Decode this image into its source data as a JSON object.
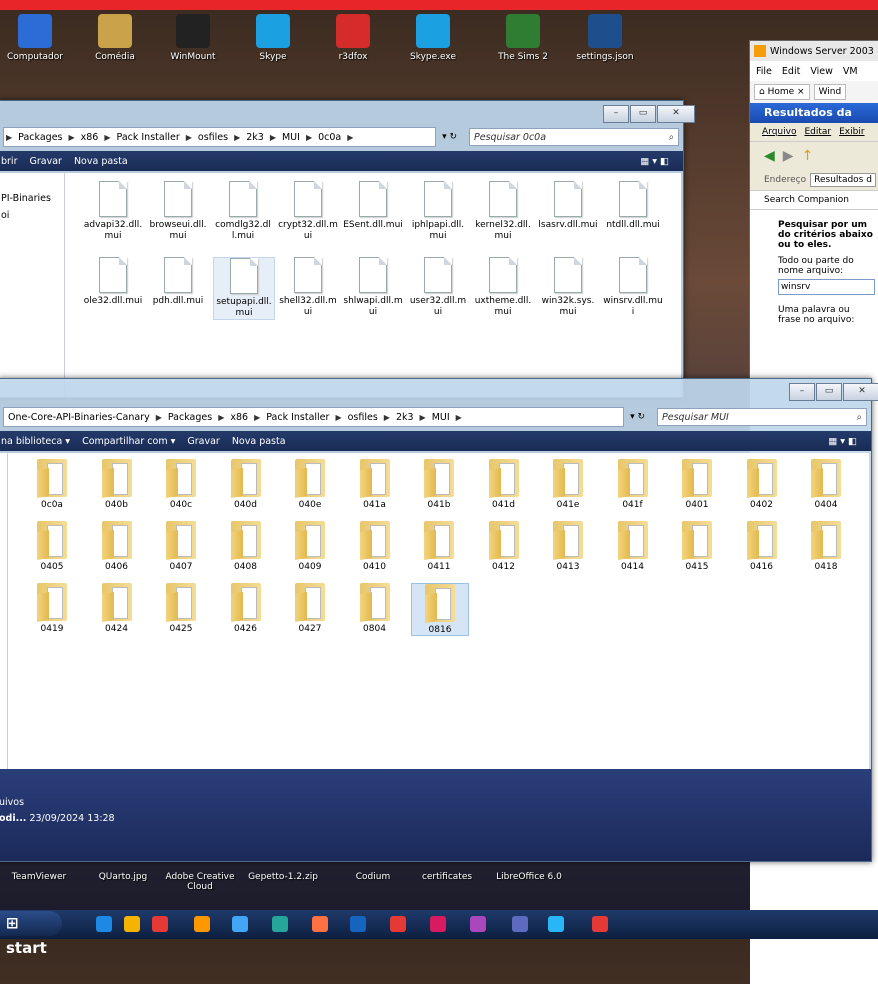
{
  "desktop": {
    "icons": [
      {
        "label": "Computador",
        "color": "#2b6cd6"
      },
      {
        "label": "Comédia",
        "color": "#c9a24a"
      },
      {
        "label": "WinMount",
        "color": "#222222"
      },
      {
        "label": "Skype",
        "color": "#1ba1e2"
      },
      {
        "label": "r3dfox",
        "color": "#d62b2b"
      },
      {
        "label": "Skype.exe",
        "color": "#1ba1e2"
      },
      {
        "label": "The Sims 2",
        "color": "#2e7d32"
      },
      {
        "label": "settings.json",
        "color": "#1e4f8c"
      }
    ],
    "bottom_icons": [
      "TeamViewer",
      "QUarto.jpg",
      "Adobe Creative Cloud",
      "Gepetto-1.2.zip",
      "Codium",
      "certificates",
      "LibreOffice 6.0"
    ]
  },
  "win1": {
    "breadcrumb": [
      "Packages",
      "x86",
      "Pack Installer",
      "osfiles",
      "2k3",
      "MUI",
      "0c0a"
    ],
    "search_placeholder": "Pesquisar 0c0a",
    "toolbar": [
      "brir",
      "Gravar",
      "Nova pasta"
    ],
    "nav_items": [
      "PI-Binaries",
      "oi"
    ],
    "files": [
      "advapi32.dll.mui",
      "browseui.dll.mui",
      "comdlg32.dll.mui",
      "crypt32.dll.mui",
      "ESent.dll.mui",
      "iphlpapi.dll.mui",
      "kernel32.dll.mui",
      "lsasrv.dll.mui",
      "ntdll.dll.mui",
      "ole32.dll.mui",
      "pdh.dll.mui",
      "setupapi.dll.mui",
      "shell32.dll.mui",
      "shlwapi.dll.mui",
      "user32.dll.mui",
      "uxtheme.dll.mui",
      "win32k.sys.mui",
      "winsrv.dll.mui"
    ]
  },
  "win2": {
    "breadcrumb": [
      "One-Core-API-Binaries-Canary",
      "Packages",
      "x86",
      "Pack Installer",
      "osfiles",
      "2k3",
      "MUI"
    ],
    "search_placeholder": "Pesquisar MUI",
    "toolbar": [
      "na biblioteca ▾",
      "Compartilhar com ▾",
      "Gravar",
      "Nova pasta"
    ],
    "folders": [
      "0c0a",
      "040b",
      "040c",
      "040d",
      "040e",
      "041a",
      "041b",
      "041d",
      "041e",
      "041f",
      "0401",
      "0402",
      "0404",
      "0405",
      "0406",
      "0407",
      "0408",
      "0409",
      "0410",
      "0411",
      "0412",
      "0413",
      "0414",
      "0415",
      "0416",
      "0418",
      "0419",
      "0424",
      "0425",
      "0426",
      "0427",
      "0804",
      "0816"
    ],
    "details_line1": "uivos",
    "details_line2_bold": "odi...",
    "details_line2": "23/09/2024 13:28"
  },
  "vm": {
    "title": "Windows Server 2003",
    "menu": [
      "File",
      "Edit",
      "View",
      "VM"
    ],
    "tabs": [
      "Home",
      "Wind"
    ],
    "ie_title": "Resultados da pesq",
    "ie_menu": [
      "Arquivo",
      "Editar",
      "Exibir"
    ],
    "address_label": "Endereço",
    "address_value": "Resultados d",
    "companion": "Search Companion",
    "search_heading": "Pesquisar por um do critérios abaixo ou to eles.",
    "name_label": "Todo ou parte do nome arquivo:",
    "name_value": "winsrv",
    "phrase_label": "Uma palavra ou frase no arquivo:"
  },
  "taskbar": {
    "start": "start",
    "icons": [
      "#1e88e5",
      "#f4b400",
      "#e53935",
      "#ff9800",
      "#42a5f5",
      "#26a69a",
      "#ff7043",
      "#1565c0",
      "#e53935",
      "#d81b60",
      "#ab47bc",
      "#5c6bc0",
      "#29b6f6",
      "#e53935"
    ]
  }
}
